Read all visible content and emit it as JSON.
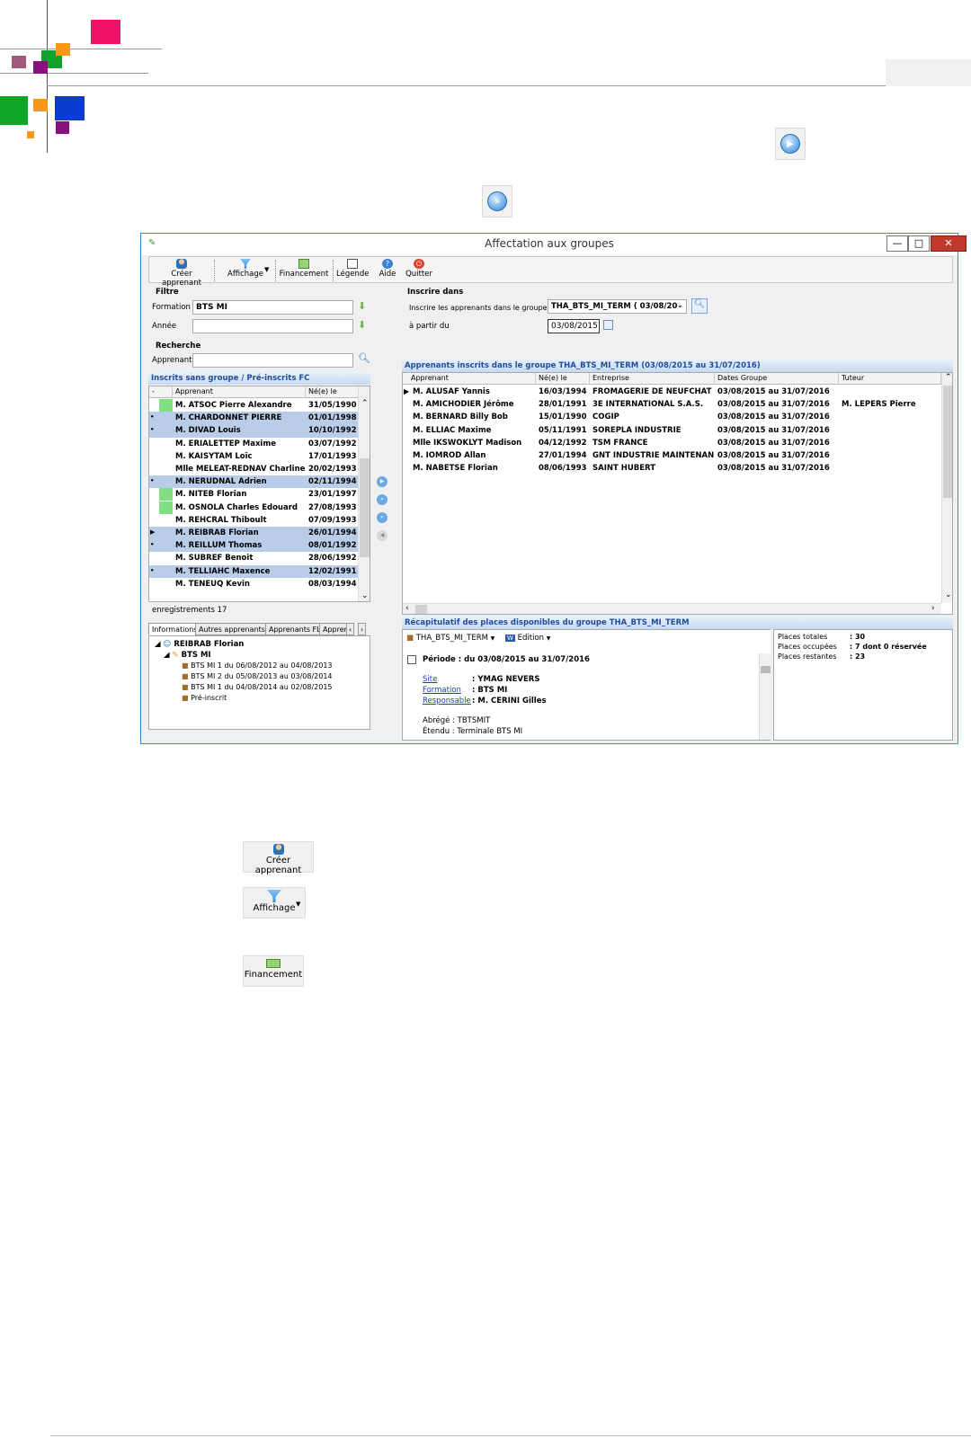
{
  "window": {
    "title": "Affectation aux groupes",
    "min_label": "—",
    "max_label": "□",
    "close_label": "✕"
  },
  "toolbar": {
    "create": "Créer apprenant",
    "display": "Affichage",
    "financing": "Financement",
    "legend": "Légende",
    "help": "Aide",
    "quit": "Quitter"
  },
  "filter": {
    "heading": "Filtre",
    "formation_label": "Formation",
    "formation_value": "BTS MI",
    "year_label": "Année",
    "year_value": ""
  },
  "search": {
    "heading": "Recherche",
    "learner_label": "Apprenant",
    "learner_value": ""
  },
  "enroll": {
    "heading": "Inscrire dans",
    "group_label": "Inscrire les apprenants dans le groupe",
    "group_value": "THA_BTS_MI_TERM ( 03/08/20",
    "from_label": "à partir du",
    "from_value": "03/08/2015"
  },
  "left_grid": {
    "heading": "Inscrits sans groupe / Pré-inscrits FC",
    "columns": [
      "-",
      "Apprenant",
      "Né(e) le"
    ],
    "rows": [
      {
        "marker": "",
        "name": "M. ATSOC Pierre Alexandre",
        "born": "31/05/1990",
        "color": "#7ee07e",
        "sel": false
      },
      {
        "marker": "•",
        "name": "M. CHARDONNET PIERRE",
        "born": "01/01/1998",
        "color": "",
        "sel": true
      },
      {
        "marker": "•",
        "name": "M. DIVAD Louis",
        "born": "10/10/1992",
        "color": "",
        "sel": true
      },
      {
        "marker": "",
        "name": "M. ERIALETTEP Maxime",
        "born": "03/07/1992",
        "color": "",
        "sel": false
      },
      {
        "marker": "",
        "name": "M. KAISYTAM Loïc",
        "born": "17/01/1993",
        "color": "",
        "sel": false
      },
      {
        "marker": "",
        "name": "Mlle MELEAT-REDNAV Charline",
        "born": "20/02/1993",
        "color": "",
        "sel": false
      },
      {
        "marker": "•",
        "name": "M. NERUDNAL Adrien",
        "born": "02/11/1994",
        "color": "",
        "sel": true
      },
      {
        "marker": "",
        "name": "M. NITEB Florian",
        "born": "23/01/1997",
        "color": "#7ee07e",
        "sel": false
      },
      {
        "marker": "",
        "name": "M. OSNOLA Charles Edouard",
        "born": "27/08/1993",
        "color": "#7ee07e",
        "sel": false
      },
      {
        "marker": "",
        "name": "M. REHCRAL Thiboult",
        "born": "07/09/1993",
        "color": "",
        "sel": false
      },
      {
        "marker": "▶",
        "name": "M. REIBRAB Florian",
        "born": "26/01/1994",
        "color": "",
        "sel": true
      },
      {
        "marker": "•",
        "name": "M. REILLUM Thomas",
        "born": "08/01/1992",
        "color": "",
        "sel": true
      },
      {
        "marker": "",
        "name": "M. SUBREF Benoit",
        "born": "28/06/1992",
        "color": "",
        "sel": false
      },
      {
        "marker": "•",
        "name": "M. TELLIAHC Maxence",
        "born": "12/02/1991",
        "color": "",
        "sel": true
      },
      {
        "marker": "",
        "name": "M. TENEUQ Kevin",
        "born": "08/03/1994",
        "color": "",
        "sel": false
      }
    ],
    "count_label": "enregistrements 17"
  },
  "tabs": [
    "Informations",
    "Autres apprenants",
    "Apprenants FL",
    "Appren"
  ],
  "tree": {
    "root": "REIBRAB Florian",
    "formation": "BTS MI",
    "items": [
      "BTS MI 1 du 06/08/2012 au 04/08/2013",
      "BTS MI 2 du 05/08/2013 au 03/08/2014",
      "BTS MI 1 du 04/08/2014 au 02/08/2015",
      "Pré-inscrit"
    ]
  },
  "right_grid": {
    "heading": "Apprenants inscrits dans le groupe THA_BTS_MI_TERM (03/08/2015 au 31/07/2016)",
    "columns": [
      "Apprenant",
      "Né(e) le",
      "Entreprise",
      "Dates Groupe",
      "Tuteur"
    ],
    "rows": [
      {
        "name": "M. ALUSAF Yannis",
        "born": "16/03/1994",
        "company": "FROMAGERIE DE NEUFCHAT",
        "dates": "03/08/2015 au 31/07/2016",
        "tutor": ""
      },
      {
        "name": "M. AMICHODIER Jérôme",
        "born": "28/01/1991",
        "company": "3E INTERNATIONAL S.A.S.",
        "dates": "03/08/2015 au 31/07/2016",
        "tutor": "M. LEPERS Pierre"
      },
      {
        "name": "M. BERNARD Billy Bob",
        "born": "15/01/1990",
        "company": "COGIP",
        "dates": "03/08/2015 au 31/07/2016",
        "tutor": ""
      },
      {
        "name": "M. ELLIAC Maxime",
        "born": "05/11/1991",
        "company": "SOREPLA INDUSTRIE",
        "dates": "03/08/2015 au 31/07/2016",
        "tutor": ""
      },
      {
        "name": "Mlle IKSWOKLYT Madison",
        "born": "04/12/1992",
        "company": "TSM FRANCE",
        "dates": "03/08/2015 au 31/07/2016",
        "tutor": ""
      },
      {
        "name": "M. IOMROD Allan",
        "born": "27/01/1994",
        "company": "GNT INDUSTRIE MAINTENAN",
        "dates": "03/08/2015 au 31/07/2016",
        "tutor": ""
      },
      {
        "name": "M. NABETSE Florian",
        "born": "08/06/1993",
        "company": "SAINT HUBERT",
        "dates": "03/08/2015 au 31/07/2016",
        "tutor": ""
      }
    ]
  },
  "recap": {
    "heading": "Récapitulatif des places disponibles du groupe THA_BTS_MI_TERM",
    "group_button": "THA_BTS_MI_TERM",
    "edition_button": "Edition",
    "period": "Période : du 03/08/2015 au 31/07/2016",
    "site_label": "Site",
    "site_value": ": YMAG NEVERS",
    "formation_label": "Formation",
    "formation_value": ": BTS MI",
    "resp_label": "Responsable",
    "resp_value": ": M. CERINI Gilles",
    "abbr": "Abrégé : TBTSMIT",
    "extended": "Étendu : Terminale BTS MI",
    "total_label": "Places totales",
    "total_value": ": 30",
    "occupied_label": "Places occupées",
    "occupied_value": ": 7 dont 0 réservée",
    "remaining_label": "Places restantes",
    "remaining_value": ": 23"
  },
  "below": {
    "create": "Créer apprenant",
    "display": "Affichage",
    "financing": "Financement"
  }
}
